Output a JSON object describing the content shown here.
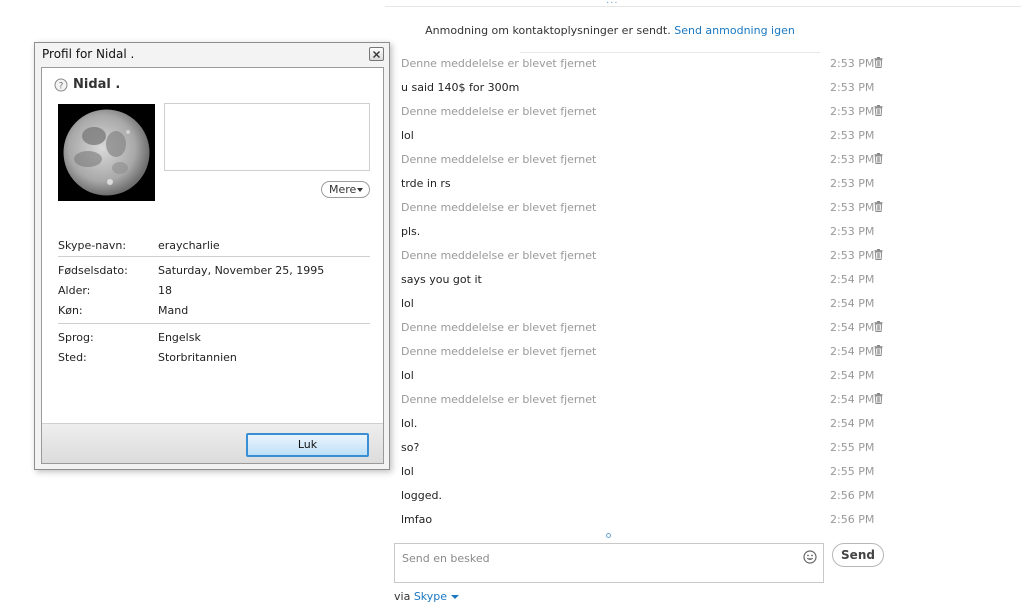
{
  "chat": {
    "notice_text": "Anmodning om kontaktoplysninger er sendt.",
    "notice_link": "Send anmodning igen",
    "messages": [
      {
        "text": "Denne meddelelse er blevet fjernet",
        "time": "2:53 PM",
        "deleted": true
      },
      {
        "text": "u said 140$ for 300m",
        "time": "2:53 PM",
        "deleted": false
      },
      {
        "text": "Denne meddelelse er blevet fjernet",
        "time": "2:53 PM",
        "deleted": true
      },
      {
        "text": "lol",
        "time": "2:53 PM",
        "deleted": false
      },
      {
        "text": "Denne meddelelse er blevet fjernet",
        "time": "2:53 PM",
        "deleted": true
      },
      {
        "text": "trde in rs",
        "time": "2:53 PM",
        "deleted": false
      },
      {
        "text": "Denne meddelelse er blevet fjernet",
        "time": "2:53 PM",
        "deleted": true
      },
      {
        "text": "pls.",
        "time": "2:53 PM",
        "deleted": false
      },
      {
        "text": "Denne meddelelse er blevet fjernet",
        "time": "2:53 PM",
        "deleted": true
      },
      {
        "text": "says you got it",
        "time": "2:54 PM",
        "deleted": false
      },
      {
        "text": "lol",
        "time": "2:54 PM",
        "deleted": false
      },
      {
        "text": "Denne meddelelse er blevet fjernet",
        "time": "2:54 PM",
        "deleted": true
      },
      {
        "text": "Denne meddelelse er blevet fjernet",
        "time": "2:54 PM",
        "deleted": true
      },
      {
        "text": "lol",
        "time": "2:54 PM",
        "deleted": false
      },
      {
        "text": "Denne meddelelse er blevet fjernet",
        "time": "2:54 PM",
        "deleted": true
      },
      {
        "text": "lol.",
        "time": "2:54 PM",
        "deleted": false
      },
      {
        "text": "so?",
        "time": "2:55 PM",
        "deleted": false
      },
      {
        "text": "lol",
        "time": "2:55 PM",
        "deleted": false
      },
      {
        "text": "logged.",
        "time": "2:56 PM",
        "deleted": false
      },
      {
        "text": "lmfao",
        "time": "2:56 PM",
        "deleted": false
      }
    ],
    "input_placeholder": "Send en besked",
    "input_value": "",
    "send_label": "Send",
    "via_label": "via",
    "via_service": "Skype"
  },
  "profile": {
    "window_title": "Profil for Nidal .",
    "name": "Nidal .",
    "more_label": "Mere",
    "fields": [
      {
        "label": "Skype-navn:",
        "value": "eraycharlie"
      },
      {
        "label": "Fødselsdato:",
        "value": "Saturday, November 25, 1995"
      },
      {
        "label": "Alder:",
        "value": "18"
      },
      {
        "label": "Køn:",
        "value": "Mand"
      },
      {
        "label": "Sprog:",
        "value": "Engelsk"
      },
      {
        "label": "Sted:",
        "value": "Storbritannien"
      }
    ],
    "close_label": "Luk"
  },
  "colors": {
    "link": "#1a78c2",
    "deleted_text": "#999999",
    "button_border": "#3a8fd4"
  },
  "icons": {
    "trash": "trash-icon",
    "emoji": "smiley-icon",
    "status": "status-unknown-icon",
    "close": "close-icon"
  }
}
